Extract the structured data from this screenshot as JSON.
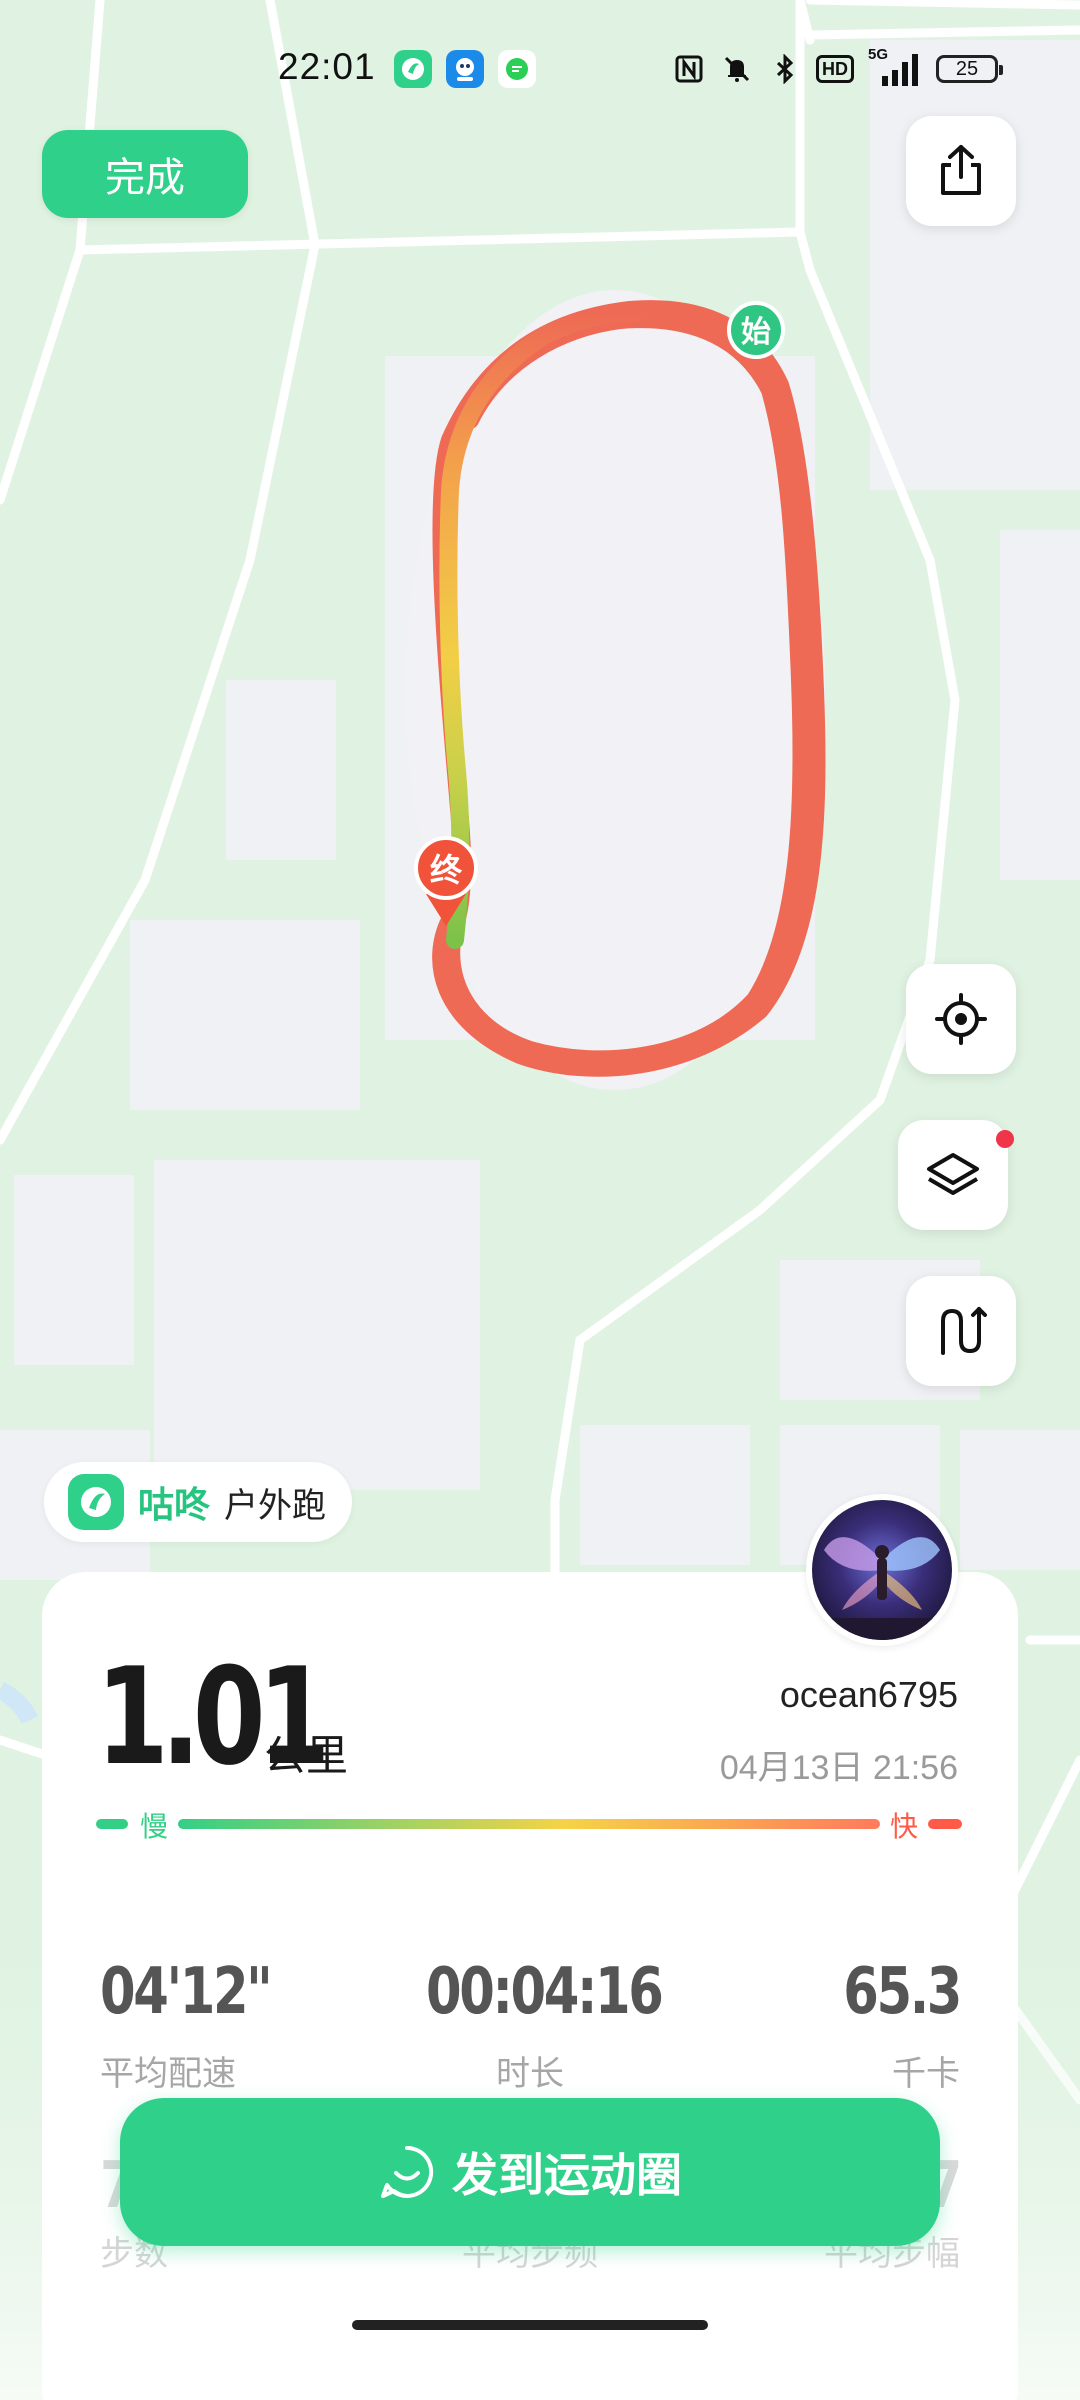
{
  "status_bar": {
    "time": "22:01",
    "network_label": "5G",
    "hd_label": "HD",
    "battery": "25",
    "apps": [
      "app-icon-gudong",
      "app-icon-baby-robot",
      "app-icon-chat"
    ]
  },
  "top": {
    "done_label": "完成",
    "share_icon": "share-icon"
  },
  "map": {
    "start_marker": "始",
    "end_marker": "终",
    "controls": [
      "locate-icon",
      "layers-icon",
      "route-icon"
    ]
  },
  "brand": {
    "name": "咕咚",
    "activity": "户外跑"
  },
  "summary": {
    "distance": "1.01",
    "distance_unit": "公里",
    "username": "ocean6795",
    "datetime": "04月13日 21:56",
    "pace_slow": "慢",
    "pace_fast": "快"
  },
  "stats": [
    {
      "value": "04'12\"",
      "label": "平均配速"
    },
    {
      "value": "00:04:16",
      "label": "时长"
    },
    {
      "value": "65.3",
      "label": "千卡"
    }
  ],
  "stats_row2": [
    {
      "value": "7",
      "label": "步数"
    },
    {
      "value": "",
      "label": "平均步频"
    },
    {
      "value": "7",
      "label": "平均步幅"
    }
  ],
  "share_button": {
    "label": "发到运动圈"
  },
  "colors": {
    "accent": "#2fd08a",
    "slow": "#33cf86",
    "fast": "#ff5a47",
    "track": "#ee6a55"
  }
}
